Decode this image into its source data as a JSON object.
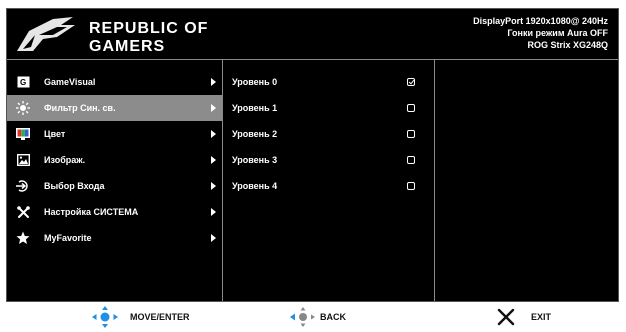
{
  "header": {
    "logo_line1": "REPUBLIC OF",
    "logo_line2": "GAMERS",
    "status_line1": "DisplayPort  1920x1080@  240Hz",
    "status_line2": "Гонки режим Aura OFF",
    "status_line3": "ROG Strix XG248Q"
  },
  "menu": {
    "items": [
      {
        "label": "GameVisual",
        "icon": "gamevisual-icon",
        "selected": false
      },
      {
        "label": "Фильтр Син. св.",
        "icon": "blue-light-icon",
        "selected": true
      },
      {
        "label": "Цвет",
        "icon": "color-icon",
        "selected": false
      },
      {
        "label": "Изображ.",
        "icon": "image-icon",
        "selected": false
      },
      {
        "label": "Выбор Входа",
        "icon": "input-icon",
        "selected": false
      },
      {
        "label": "Настройка СИСТЕМА",
        "icon": "wrench-icon",
        "selected": false
      },
      {
        "label": "MyFavorite",
        "icon": "star-icon",
        "selected": false
      }
    ]
  },
  "submenu": {
    "items": [
      {
        "label": "Уровень 0",
        "checked": true
      },
      {
        "label": "Уровень 1",
        "checked": false
      },
      {
        "label": "Уровень 2",
        "checked": false
      },
      {
        "label": "Уровень 3",
        "checked": false
      },
      {
        "label": "Уровень 4",
        "checked": false
      }
    ]
  },
  "footer": {
    "move_label": "MOVE/ENTER",
    "back_label": "BACK",
    "exit_label": "EXIT"
  },
  "colors": {
    "selected_bg": "#8c8c8c",
    "nav_blue": "#1e90e6"
  }
}
